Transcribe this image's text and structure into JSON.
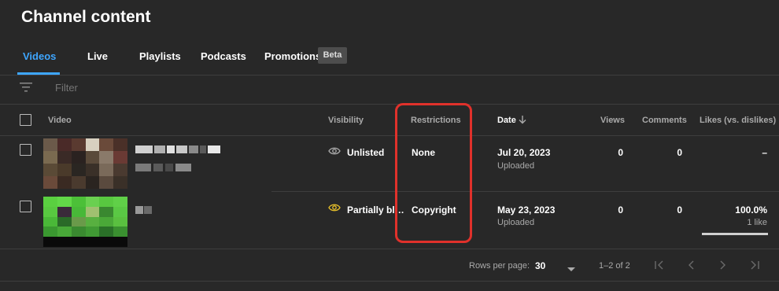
{
  "page": {
    "title": "Channel content"
  },
  "tabs": [
    {
      "label": "Videos",
      "active": true
    },
    {
      "label": "Live",
      "active": false
    },
    {
      "label": "Playlists",
      "active": false
    },
    {
      "label": "Podcasts",
      "active": false
    },
    {
      "label": "Promotions",
      "active": false
    }
  ],
  "beta_label": "Beta",
  "filter": {
    "placeholder": "Filter",
    "icon": "filter-icon"
  },
  "table": {
    "headers": {
      "video": "Video",
      "visibility": "Visibility",
      "restrictions": "Restrictions",
      "date": "Date",
      "views": "Views",
      "comments": "Comments",
      "likes": "Likes (vs. dislikes)"
    },
    "sort_icon": "arrow-down-icon",
    "rows": [
      {
        "visibility": "Unlisted",
        "visibility_icon": "eye-icon",
        "visibility_color": "#aaaaaa",
        "restrictions": "None",
        "date": "Jul 20, 2023",
        "date_status": "Uploaded",
        "views": "0",
        "comments": "0",
        "likes": "–",
        "likes_sub": ""
      },
      {
        "visibility": "Partially bl…",
        "visibility_icon": "eye-icon",
        "visibility_color": "#e8c02a",
        "restrictions": "Copyright",
        "date": "May 23, 2023",
        "date_status": "Uploaded",
        "views": "0",
        "comments": "0",
        "likes": "100.0%",
        "likes_sub": "1 like",
        "likes_ratio": 1.0
      }
    ]
  },
  "pagination": {
    "rows_per_page_label": "Rows per page:",
    "rows_per_page_value": "30",
    "range": "1–2 of 2"
  },
  "colors": {
    "accent": "#3ea6ff",
    "highlight": "#e0312b",
    "background": "#282828"
  }
}
